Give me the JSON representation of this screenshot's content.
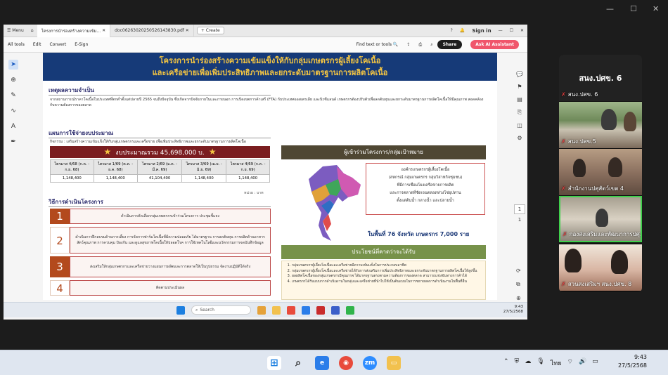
{
  "window": {
    "controls": [
      "‹",
      "›",
      "⤢",
      "—",
      "☐",
      "✕"
    ]
  },
  "acrobat": {
    "menu": "Menu",
    "home_icon": "home-icon",
    "tabs": [
      {
        "label": "โครงการนำร่องสร้างความเข้ม...",
        "close": "✕"
      },
      {
        "label": "doc06263020250526143830.pdf",
        "close": "✕"
      }
    ],
    "create": "+ Create",
    "signin": "Sign in",
    "tools": [
      "All tools",
      "Edit",
      "Convert",
      "E-Sign"
    ],
    "find": "Find text or tools",
    "share": "Share",
    "ai": "Ask AI Assistant",
    "page_current": "1",
    "page_total": "1"
  },
  "slide": {
    "banner_line1": "โครงการนำร่องสร้างความเข้มแข็งให้กับกลุ่มเกษตรกรผู้เลี้ยงโคเนื้อ",
    "banner_line2": "และเครือข่ายเพื่อเพิ่มประสิทธิภาพและยกระดับมาตรฐานการผลิตโคเนื้อ",
    "reason_title": "เหตุผลความจำเป็น",
    "reason_text": "จากสถานการณ์ราคาโคเนื้อในประเทศที่ตกต่ำตั้งแต่ปลายปี 2565 จนถึงปัจจุบัน ซึ่งเกิดจากปัจจัยภายในและภายนอก การเปิดเขตการค้าเสรี (FTA) กับประเทศออสเตรเลีย และนิวซีแลนด์ เกษตรกรต้องปรับตัวเพื่อลดต้นทุนและยกระดับมาตรฐานการผลิตโคเนื้อให้มีคุณภาพ สอดคล้องกับความต้องการของตลาด",
    "plan_title": "แผนการใช้จ่ายงบประมาณ",
    "plan_text": "กิจกรรม : เสริมสร้างความเข้มแข็งให้กับกลุ่มเกษตรกรและเครือข่าย เพื่อเพิ่มประสิทธิภาพและยกระดับมาตรฐานการผลิตโคเนื้อ",
    "budget": "งบประมาณรวม 45,698,000 บ.",
    "star": "★",
    "quarters": [
      "ไตรมาส 4/68 (ก.ค. - ก.ย. 68)",
      "ไตรมาส 1/69 (ต.ค. - ธ.ค. 68)",
      "ไตรมาส 2/69 (ม.ค. - มี.ค. 69)",
      "ไตรมาส 3/69 (เม.ย. - มิ.ย. 69)",
      "ไตรมาส 4/69 (ก.ค. - ก.ย. 69)"
    ],
    "amounts": [
      "1,148,400",
      "1,148,400",
      "41,104,400",
      "1,148,400",
      "1,148,400"
    ],
    "unit": "หน่วย : บาท",
    "method_title": "วิธีการดำเนินโครงการ",
    "steps": [
      {
        "n": "1",
        "t": "ดำเนินการคัดเลือกกลุ่มเกษตรกรเข้าร่วมโครงการ ประชุมชี้แจง"
      },
      {
        "n": "2",
        "t": "ดำเนินการฝึกอบรมด้านการเลี้ยง การจัดการฟาร์มโคเนื้อที่มีความปลอดภัย ได้มาตรฐาน การลดต้นทุน การผลิตด้านอาหารสัตว์คุณภาพ การควบคุม ป้องกัน และดูแลสุขภาพโคเนื้อให้ปลอดโรค การใช้เทคโนโลยีและนวัตกรรมการจดบันทึกข้อมูล"
      },
      {
        "n": "3",
        "t": "ส่งเสริมให้กลุ่มเกษตรกรและเครือข่ายวางแผนการผลิตและการตลาดให้เป็นรูปธรรม จัดงานปฏิบัติได้จริง"
      },
      {
        "n": "4",
        "t": "ติดตามประเมินผล"
      }
    ],
    "participants_title": "ผู้เข้าร่วมโครงการ/กลุ่มเป้าหมาย",
    "org_lines": [
      "องค์กรเกษตรกรผู้เลี้ยงโคเนื้อ",
      "(สหกรณ์ กลุ่มเกษตรกร กลุ่มวิสาหกิจชุมชน)",
      "ที่มีการเชื่อมโยงเครือข่ายการผลิต",
      "และการตลาดที่ชัดเจนตลอดห่วงโซ่อุปทาน",
      "ตั้งแต่ต้นน้ำ กลางน้ำ และปลายน้ำ"
    ],
    "kpi": "ในพื้นที่ 76 จังหวัด  เกษตรกร 7,000 ราย",
    "benefit_title": "ประโยชน์ที่คาดว่าจะได้รับ",
    "benefits": [
      "กลุ่มเกษตรกรผู้เลี้ยงโคเนื้อและเครือข่ายมีความเข้มแข็งในการประกอบอาชีพ",
      "กลุ่มเกษตรกรผู้เลี้ยงโคเนื้อและเครือข่ายได้รับการส่งเสริมการเพิ่มประสิทธิภาพและยกระดับมาตรฐานการผลิตโคเนื้อให้สูงขึ้น",
      "ผลผลิตโคเนื้อของกลุ่มเกษตรกรมีคุณภาพ ได้มาตรฐานตรงตามความต้องการของตลาด สามารถแข่งขันทางการค้าได้",
      "เกษตรกรได้รับแบบการดำเนินงานในกลุ่มและเครือข่ายที่นำไปใช้เป็นต้นแบบในการขยายผลการดำเนินงานในพื้นที่อื่น"
    ]
  },
  "win": {
    "search": "Search",
    "time": "9:43",
    "date": "27/5/2568"
  },
  "gallery": {
    "title": "สนง.ปศข. 6",
    "t0": "สนง.ปศข. 6",
    "t1": "สนง.ปศข.5",
    "t2": "สำนักงานปศุสัตว์เขต 4",
    "t3": "กองส่งเสริมและพัฒนาการปศุ...",
    "t4": "สวนสงเสริมฯ สนง.ปศข. 8"
  },
  "taskbar": {
    "lang": "ไทย",
    "time": "9:43",
    "date": "27/5/2568"
  }
}
